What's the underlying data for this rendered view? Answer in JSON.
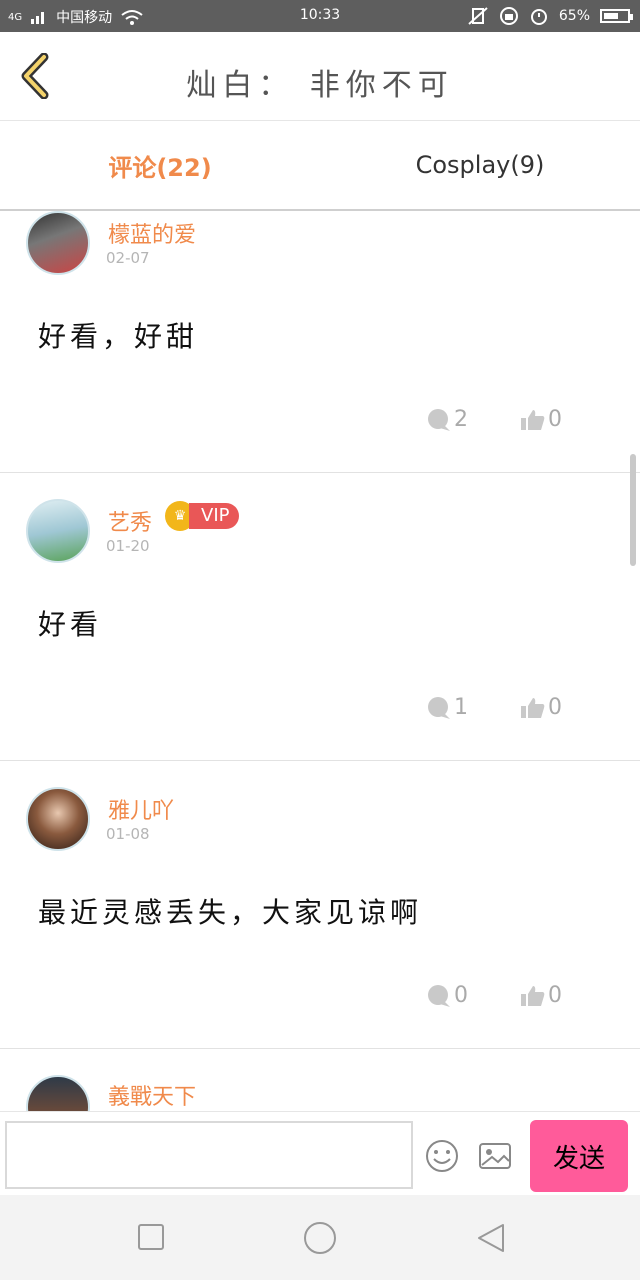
{
  "status_bar": {
    "network": "4G",
    "carrier": "中国移动",
    "time": "10:33",
    "battery": "65%"
  },
  "header": {
    "title": "灿白： 非你不可"
  },
  "tabs": [
    {
      "label": "评论(22)",
      "active": true
    },
    {
      "label": "Cosplay(9)",
      "active": false
    }
  ],
  "comments": [
    {
      "username": "檬蓝的爱",
      "date": "02-07",
      "content": "好看，好甜",
      "reply_count": "2",
      "like_count": "0",
      "vip": false
    },
    {
      "username": "艺秀",
      "date": "01-20",
      "content": "好看",
      "reply_count": "1",
      "like_count": "0",
      "vip": true,
      "vip_label": "VIP"
    },
    {
      "username": "雅儿吖",
      "date": "01-08",
      "content": "最近灵感丢失，大家见谅啊",
      "reply_count": "0",
      "like_count": "0",
      "vip": false
    },
    {
      "username": "義戰天下"
    }
  ],
  "input": {
    "placeholder": "",
    "send_label": "发送"
  },
  "colors": {
    "accent": "#f08a4b",
    "send": "#ff5b9a",
    "vip": "#e95757"
  }
}
